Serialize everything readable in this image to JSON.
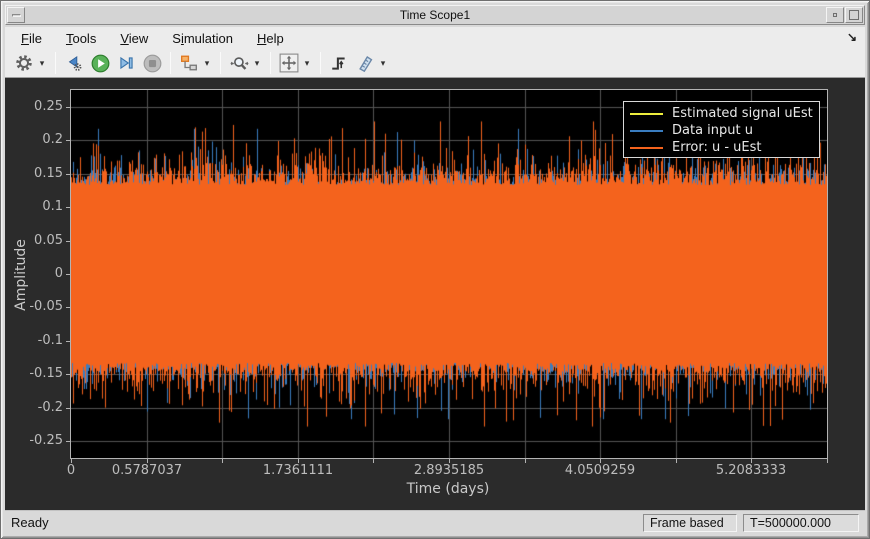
{
  "window": {
    "title": "Time Scope1"
  },
  "menubar": {
    "items": [
      {
        "label": "File",
        "underline": 0
      },
      {
        "label": "Tools",
        "underline": 0
      },
      {
        "label": "View",
        "underline": 0
      },
      {
        "label": "Simulation",
        "underline": 1
      },
      {
        "label": "Help",
        "underline": 0
      }
    ],
    "dock_glyph": "↘"
  },
  "toolbar": {
    "caret_glyph": "▾",
    "icons": [
      "settings-gear",
      "step-backward",
      "run",
      "step-forward",
      "stop",
      "highlight-simulink-block",
      "zoom",
      "scale-axes",
      "trigger",
      "cursor-measurements"
    ]
  },
  "chart_data": {
    "type": "line",
    "title": "",
    "xlabel": "Time (days)",
    "ylabel": "Amplitude",
    "xlim": [
      0,
      5.787037
    ],
    "ylim": [
      -0.275,
      0.275
    ],
    "grid": true,
    "background_color": "#000000",
    "grid_color": "#565656",
    "axis_color": "#b3b3b3",
    "xticks": [
      {
        "value": 0,
        "label": "0"
      },
      {
        "value": 0.5787037,
        "label": "0.5787037"
      },
      {
        "value": 1.1574074,
        "label": ""
      },
      {
        "value": 1.7361111,
        "label": "1.7361111"
      },
      {
        "value": 2.3148148,
        "label": ""
      },
      {
        "value": 2.8935185,
        "label": "2.8935185"
      },
      {
        "value": 3.4722222,
        "label": ""
      },
      {
        "value": 4.0509259,
        "label": "4.0509259"
      },
      {
        "value": 4.6296296,
        "label": ""
      },
      {
        "value": 5.2083333,
        "label": "5.2083333"
      },
      {
        "value": 5.787037,
        "label": ""
      }
    ],
    "yticks": [
      {
        "value": 0.25,
        "label": "0.25"
      },
      {
        "value": 0.2,
        "label": "0.2"
      },
      {
        "value": 0.15,
        "label": "0.15"
      },
      {
        "value": 0.1,
        "label": "0.1"
      },
      {
        "value": 0.05,
        "label": "0.05"
      },
      {
        "value": 0,
        "label": "0"
      },
      {
        "value": -0.05,
        "label": "-0.05"
      },
      {
        "value": -0.1,
        "label": "-0.1"
      },
      {
        "value": -0.15,
        "label": "-0.15"
      },
      {
        "value": -0.2,
        "label": "-0.2"
      },
      {
        "value": -0.25,
        "label": "-0.25"
      }
    ],
    "legend": {
      "position": "top-right",
      "entries": [
        {
          "label": "Estimated signal uEst",
          "color": "#eded3d"
        },
        {
          "label": "Data input u",
          "color": "#3a7dc0"
        },
        {
          "label": "Error: u - uEst",
          "color": "#f4631d"
        }
      ]
    },
    "series": [
      {
        "name": "Estimated signal uEst",
        "color": "#eded3d",
        "render": "hidden-near-zero",
        "band_amplitude": 0.0
      },
      {
        "name": "Data input u",
        "color": "#3a7dc0",
        "render": "noise-band",
        "band_amplitude": 0.132,
        "spike_tail_mean": 0.011,
        "tall_spike_prob": 0.12,
        "tall_spike_mean": 0.032,
        "spike_max": 0.085
      },
      {
        "name": "Error: u - uEst",
        "color": "#f4631d",
        "render": "noise-band",
        "band_amplitude": 0.133,
        "spike_tail_mean": 0.02,
        "tall_spike_prob": 0.05,
        "tall_spike_mean": 0.035,
        "spike_max": 0.095
      }
    ],
    "noise_seed": 20,
    "points": 756
  },
  "statusbar": {
    "status": "Ready",
    "frame_mode": "Frame based",
    "time": "T=500000.000"
  }
}
